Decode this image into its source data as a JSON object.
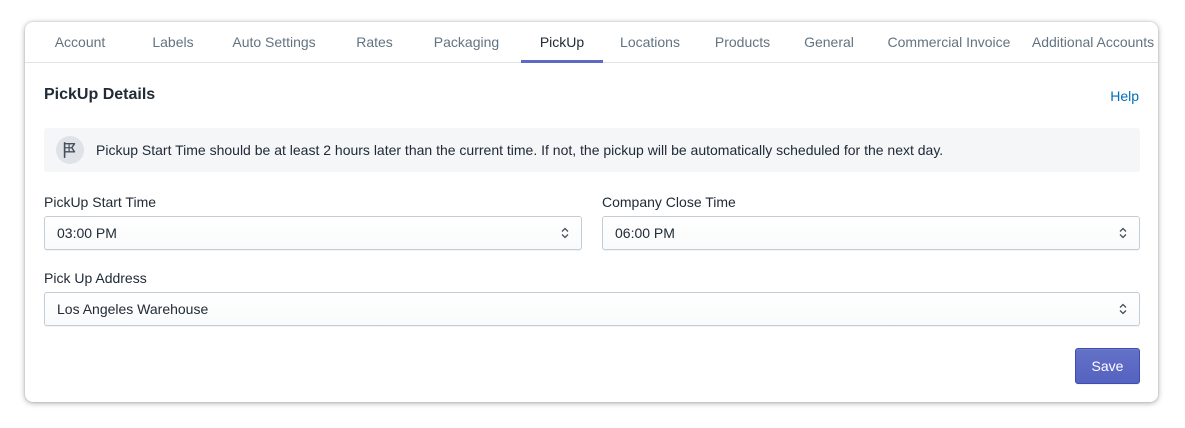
{
  "tabs": [
    {
      "label": "Account"
    },
    {
      "label": "Labels"
    },
    {
      "label": "Auto Settings"
    },
    {
      "label": "Rates"
    },
    {
      "label": "Packaging"
    },
    {
      "label": "PickUp",
      "active": true
    },
    {
      "label": "Locations"
    },
    {
      "label": "Products"
    },
    {
      "label": "General"
    },
    {
      "label": "Commercial Invoice"
    },
    {
      "label": "Additional Accounts"
    }
  ],
  "section": {
    "title": "PickUp Details",
    "help_label": "Help"
  },
  "banner": {
    "icon": "flag-icon",
    "text": "Pickup Start Time should be at least 2 hours later than the current time. If not, the pickup will be automatically scheduled for the next day."
  },
  "fields": {
    "start_time": {
      "label": "PickUp Start Time",
      "value": "03:00 PM"
    },
    "close_time": {
      "label": "Company Close Time",
      "value": "06:00 PM"
    },
    "address": {
      "label": "Pick Up Address",
      "value": "Los Angeles Warehouse"
    }
  },
  "actions": {
    "save_label": "Save"
  },
  "colors": {
    "accent": "#5c6ac4",
    "link": "#006fbb",
    "banner_bg": "#f4f6f8",
    "text": "#212b36",
    "muted": "#637381"
  }
}
